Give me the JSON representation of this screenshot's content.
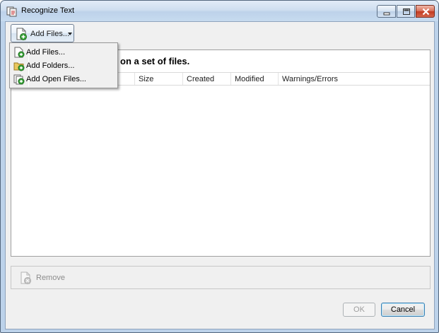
{
  "window": {
    "title": "Recognize Text"
  },
  "toolbar": {
    "add_files_label": "Add Files...",
    "add_files_icon": "add-file-icon",
    "dropdown_icon": "chevron-down-icon"
  },
  "panel": {
    "heading_visible_fragment": "R on a set of files.",
    "columns": [
      "Size",
      "Created",
      "Modified",
      "Warnings/Errors"
    ],
    "rows": []
  },
  "footer": {
    "remove_label": "Remove",
    "remove_icon": "remove-file-icon"
  },
  "dialog_buttons": {
    "ok_label": "OK",
    "cancel_label": "Cancel"
  },
  "menu": {
    "items": [
      {
        "label": "Add Files...",
        "icon": "add-file-icon"
      },
      {
        "label": "Add Folders...",
        "icon": "add-folder-icon"
      },
      {
        "label": "Add Open Files...",
        "icon": "add-open-files-icon"
      }
    ]
  },
  "colors": {
    "frame": "#bcd2ea",
    "close_button": "#c23a20",
    "default_button_border": "#3c7fb1"
  }
}
